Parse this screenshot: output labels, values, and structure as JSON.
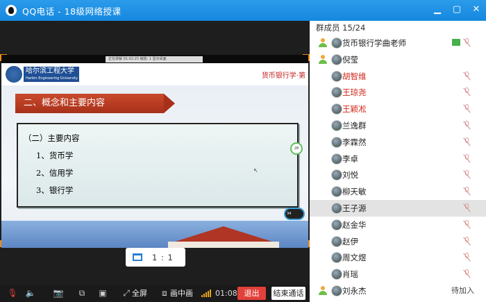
{
  "window": {
    "app_name": "QQ电话",
    "title": "QQ电话 - 18级网络授课",
    "buttons": [
      "minimize",
      "maximize",
      "close"
    ]
  },
  "slide": {
    "info_bar": "正在讲解 01:02:25   缩放: 1   显示桌面",
    "school_name": "哈尔滨工程大学",
    "school_name_en": "Harbin Engineering University",
    "course_title": "货币银行学·第",
    "section_title": "二、概念和主要内容",
    "content_heading": "（二）主要内容",
    "items": [
      "1、货币学",
      "2、信用学",
      "3、银行学"
    ],
    "badge_top": "28",
    "badge_bottom": "34"
  },
  "ratio": {
    "label": "1 : 1"
  },
  "toolbar": {
    "fullscreen_label": "全屏",
    "pip_label": "画中画",
    "timer": "01:08",
    "exit_label": "退出",
    "end_call_label": "结束通话",
    "signal_level": 5
  },
  "members": {
    "header": "群成员 15/24",
    "list": [
      {
        "name": "货币银行学曲老师",
        "red": false,
        "status": "screen-share",
        "pending": ""
      },
      {
        "name": "倪莹",
        "red": false,
        "status": "",
        "pending": ""
      },
      {
        "name": "胡智维",
        "red": true,
        "status": "muted",
        "pending": ""
      },
      {
        "name": "王琼尧",
        "red": true,
        "status": "muted",
        "pending": ""
      },
      {
        "name": "王颖凇",
        "red": true,
        "status": "muted",
        "pending": ""
      },
      {
        "name": "兰逸群",
        "red": false,
        "status": "muted",
        "pending": ""
      },
      {
        "name": "李霖然",
        "red": false,
        "status": "muted",
        "pending": ""
      },
      {
        "name": "李卓",
        "red": false,
        "status": "muted",
        "pending": ""
      },
      {
        "name": "刘悦",
        "red": false,
        "status": "muted",
        "pending": ""
      },
      {
        "name": "柳天敏",
        "red": false,
        "status": "muted",
        "pending": ""
      },
      {
        "name": "王子源",
        "red": false,
        "status": "muted",
        "pending": "",
        "selected": true
      },
      {
        "name": "赵金华",
        "red": false,
        "status": "muted",
        "pending": ""
      },
      {
        "name": "赵伊",
        "red": false,
        "status": "muted",
        "pending": ""
      },
      {
        "name": "周文煜",
        "red": false,
        "status": "muted",
        "pending": ""
      },
      {
        "name": "肖瑶",
        "red": false,
        "status": "muted",
        "pending": ""
      },
      {
        "name": "刘永杰",
        "red": false,
        "status": "",
        "pending": "待加入"
      }
    ]
  },
  "colors": {
    "titlebar": "#1a8de3",
    "accent_orange": "#f08a12",
    "exit_red": "#e2403a",
    "name_red": "#d2261a"
  }
}
